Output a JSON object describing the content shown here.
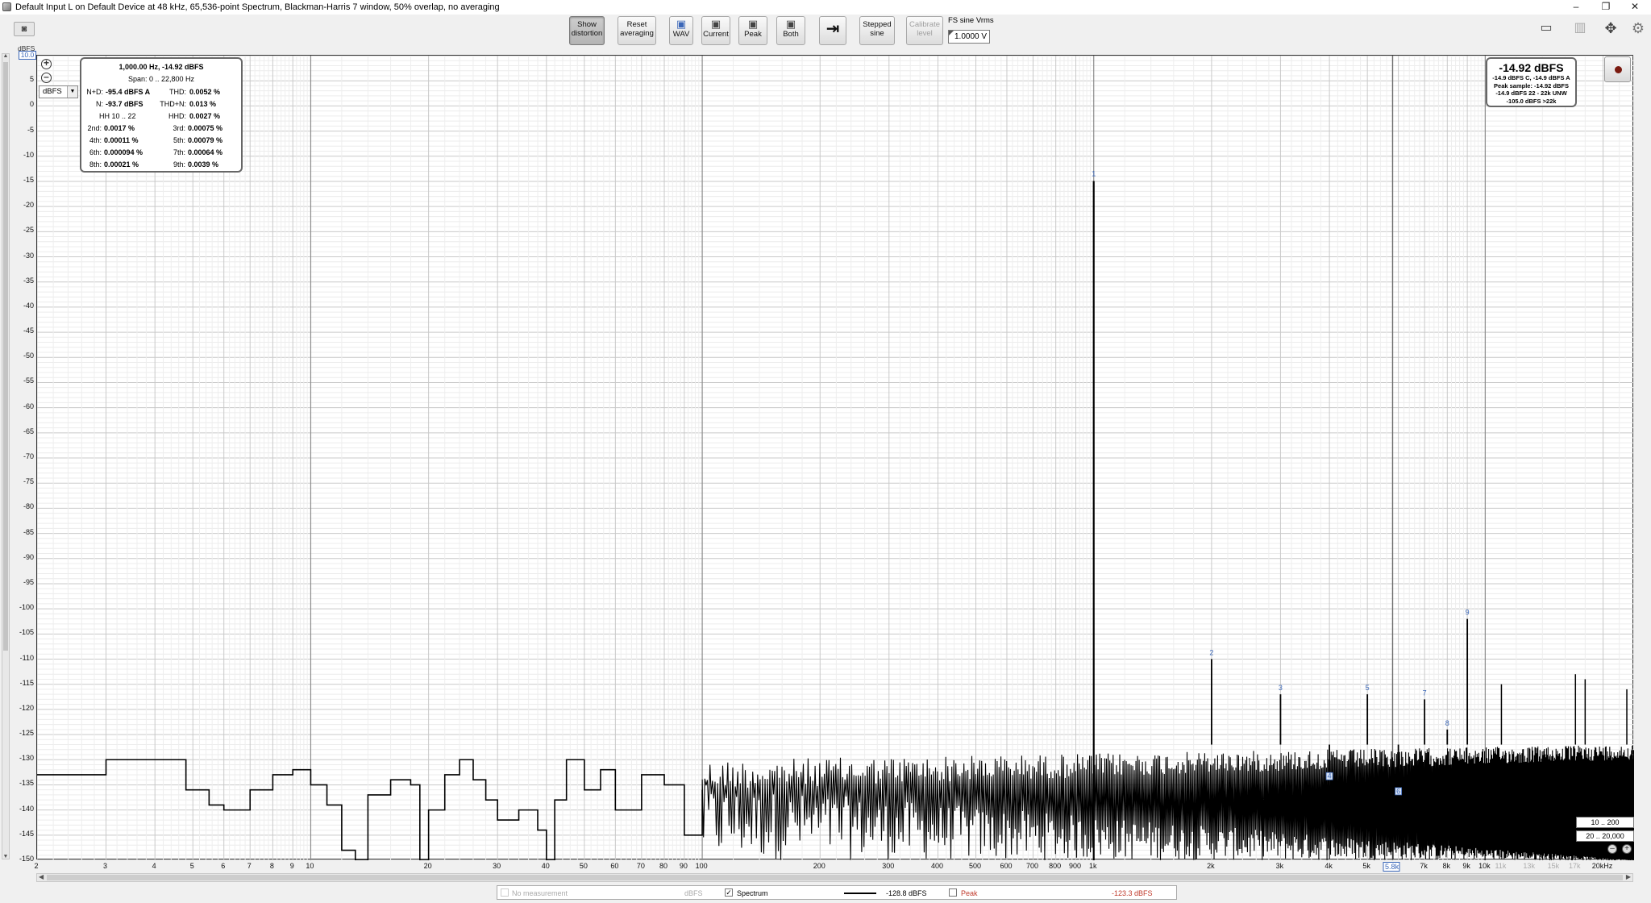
{
  "window": {
    "title": "Default Input L on Default Device at 48 kHz, 65,536-point Spectrum, Blackman-Harris 7 window, 50% overlap, no averaging",
    "minimize": "–",
    "restore": "❐",
    "close": "✕"
  },
  "toolbar": {
    "show_distortion": "Show distortion",
    "reset_averaging": "Reset averaging",
    "wav": "WAV",
    "current": "Current",
    "peak": "Peak",
    "both": "Both",
    "stepped_sine": "Stepped sine",
    "calibrate_level": "Calibrate level",
    "fs_label": "FS sine Vrms",
    "fs_value": "1.0000 V"
  },
  "y_axis": {
    "unit": "dBFS",
    "scale_box": "10.0",
    "ticks": [
      "5",
      "0",
      "-5",
      "-10",
      "-15",
      "-20",
      "-25",
      "-30",
      "-35",
      "-40",
      "-45",
      "-50",
      "-55",
      "-60",
      "-65",
      "-70",
      "-75",
      "-80",
      "-85",
      "-90",
      "-95",
      "-100",
      "-105",
      "-110",
      "-115",
      "-120",
      "-125",
      "-130",
      "-135",
      "-140",
      "-145",
      "-150"
    ]
  },
  "x_axis": {
    "ticks": [
      {
        "label": "2",
        "f": 2
      },
      {
        "label": "3",
        "f": 3
      },
      {
        "label": "4",
        "f": 4
      },
      {
        "label": "5",
        "f": 5
      },
      {
        "label": "6",
        "f": 6
      },
      {
        "label": "7",
        "f": 7
      },
      {
        "label": "8",
        "f": 8
      },
      {
        "label": "9",
        "f": 9
      },
      {
        "label": "10",
        "f": 10
      },
      {
        "label": "20",
        "f": 20
      },
      {
        "label": "30",
        "f": 30
      },
      {
        "label": "40",
        "f": 40
      },
      {
        "label": "50",
        "f": 50
      },
      {
        "label": "60",
        "f": 60
      },
      {
        "label": "70",
        "f": 70
      },
      {
        "label": "80",
        "f": 80
      },
      {
        "label": "90",
        "f": 90
      },
      {
        "label": "100",
        "f": 100
      },
      {
        "label": "200",
        "f": 200
      },
      {
        "label": "300",
        "f": 300
      },
      {
        "label": "400",
        "f": 400
      },
      {
        "label": "500",
        "f": 500
      },
      {
        "label": "600",
        "f": 600
      },
      {
        "label": "700",
        "f": 700
      },
      {
        "label": "800",
        "f": 800
      },
      {
        "label": "900",
        "f": 900
      },
      {
        "label": "1k",
        "f": 1000
      },
      {
        "label": "2k",
        "f": 2000
      },
      {
        "label": "3k",
        "f": 3000
      },
      {
        "label": "4k",
        "f": 4000
      },
      {
        "label": "5k",
        "f": 5000
      },
      {
        "label": "5.8k",
        "f": 5800,
        "boxed": true
      },
      {
        "label": "7k",
        "f": 7000
      },
      {
        "label": "8k",
        "f": 8000
      },
      {
        "label": "9k",
        "f": 9000
      },
      {
        "label": "10k",
        "f": 10000
      },
      {
        "label": "11k",
        "f": 11000,
        "grey": true
      },
      {
        "label": "13k",
        "f": 13000,
        "grey": true
      },
      {
        "label": "15k",
        "f": 15000,
        "grey": true
      },
      {
        "label": "17k",
        "f": 17000,
        "grey": true
      },
      {
        "label": "20kHz",
        "f": 20000
      }
    ]
  },
  "distortion": {
    "header": "1,000.00 Hz, -14.92 dBFS",
    "span": "Span: 0 .. 22,800 Hz",
    "n_d_label": "N+D:",
    "n_d": "-95.4 dBFS A",
    "thd_label": "THD:",
    "thd": "0.0052 %",
    "n_label": "N:",
    "n": "-93.7 dBFS",
    "thd_n_label": "THD+N:",
    "thd_n": "0.013 %",
    "hh": "HH 10 .. 22",
    "hhd_label": "HHD:",
    "hhd": "0.0027 %",
    "h2_label": "2nd:",
    "h2": "0.0017 %",
    "h3_label": "3rd:",
    "h3": "0.00075 %",
    "h4_label": "4th:",
    "h4": "0.00011 %",
    "h5_label": "5th:",
    "h5": "0.00079 %",
    "h6_label": "6th:",
    "h6": "0.000094 %",
    "h7_label": "7th:",
    "h7": "0.00064 %",
    "h8_label": "8th:",
    "h8": "0.00021 %",
    "h9_label": "9th:",
    "h9": "0.0039 %"
  },
  "level": {
    "main": "-14.92 dBFS",
    "line1": "-14.9 dBFS C, -14.9 dBFS A",
    "line2": "Peak sample: -14.92 dBFS",
    "line3": "-14.9 dBFS 22 - 22k UNW",
    "line4": "-105.0 dBFS >22k"
  },
  "unit_select": "dBFS",
  "range_buttons": {
    "y": "10 .. 200",
    "x": "20 .. 20,000"
  },
  "legend": {
    "no_measurement": "No measurement",
    "nm_unit": "dBFS",
    "spectrum": "Spectrum",
    "spectrum_value": "-128.8 dBFS",
    "peak": "Peak",
    "peak_value": "-123.3 dBFS"
  },
  "colors": {
    "accent": "#3b67b8",
    "peak_text": "#c0392b",
    "trace": "#000000"
  },
  "chart_data": {
    "type": "line",
    "x_scale": "log",
    "xlim": [
      2,
      24000
    ],
    "ylim": [
      -150,
      10
    ],
    "ylabel": "dBFS",
    "fundamental": {
      "freq": 1000,
      "level": -14.92,
      "label": "1"
    },
    "harmonics": [
      {
        "label": "2",
        "freq": 2000,
        "level": -110
      },
      {
        "label": "3",
        "freq": 3000,
        "level": -117
      },
      {
        "label": "4",
        "freq": 4000,
        "level": -134
      },
      {
        "label": "5",
        "freq": 5000,
        "level": -117
      },
      {
        "label": "6",
        "freq": 6000,
        "level": -137
      },
      {
        "label": "7",
        "freq": 7000,
        "level": -118
      },
      {
        "label": "8",
        "freq": 8000,
        "level": -124
      },
      {
        "label": "9",
        "freq": 9000,
        "level": -102
      }
    ],
    "extra_spurs": [
      {
        "freq": 11000,
        "level": -115
      },
      {
        "freq": 17000,
        "level": -113
      },
      {
        "freq": 18000,
        "level": -114
      },
      {
        "freq": 23000,
        "level": -116
      }
    ],
    "low_freq_trace": [
      [
        2,
        -133
      ],
      [
        3,
        -130
      ],
      [
        4,
        -130
      ],
      [
        4.8,
        -136
      ],
      [
        5.5,
        -139
      ],
      [
        6,
        -140
      ],
      [
        7,
        -136
      ],
      [
        8,
        -133
      ],
      [
        9,
        -132
      ],
      [
        10,
        -135
      ],
      [
        11,
        -139
      ],
      [
        12,
        -148
      ],
      [
        13,
        -150
      ],
      [
        14,
        -137
      ],
      [
        16,
        -134
      ],
      [
        18,
        -135
      ],
      [
        19,
        -150
      ],
      [
        20,
        -140
      ],
      [
        22,
        -133
      ],
      [
        24,
        -130
      ],
      [
        26,
        -134
      ],
      [
        28,
        -138
      ],
      [
        30,
        -142
      ],
      [
        34,
        -140
      ],
      [
        38,
        -144
      ],
      [
        40,
        -150
      ],
      [
        42,
        -138
      ],
      [
        45,
        -130
      ],
      [
        50,
        -136
      ],
      [
        55,
        -132
      ],
      [
        60,
        -140
      ],
      [
        70,
        -133
      ],
      [
        80,
        -135
      ],
      [
        90,
        -145
      ],
      [
        100,
        -136
      ]
    ],
    "noise_floor": {
      "from_hz": 100,
      "to_hz": 24000,
      "top_dbfs": -127,
      "bottom_dbfs": -150
    }
  }
}
